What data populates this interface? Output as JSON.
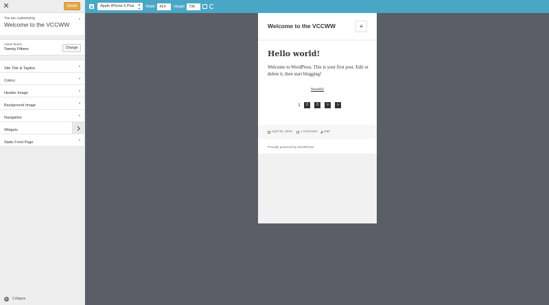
{
  "sidebar": {
    "close_glyph": "✕",
    "saved_label": "Saved",
    "info_pre": "You are customizing",
    "info_title": "Welcome to the VCCWW",
    "theme_pre": "Active theme",
    "theme_name": "Twenty Fifteen",
    "change_label": "Change",
    "sections": [
      {
        "label": "Site Title & Tagline"
      },
      {
        "label": "Colors"
      },
      {
        "label": "Header Image"
      },
      {
        "label": "Background Image"
      },
      {
        "label": "Navigation"
      },
      {
        "label": "Widgets"
      },
      {
        "label": "Static Front Page"
      }
    ],
    "collapse_label": "Collapse"
  },
  "toolbar": {
    "device": "Apple iPhone 6 Plus",
    "width_label": "Width",
    "width_value": "414",
    "height_label": "Height",
    "height_value": "736"
  },
  "preview": {
    "site_title": "Welcome to the VCCWW",
    "menu_glyph": "≡",
    "post_title": "Hello world!",
    "post_content": "Welcome to WordPress. This is your first post. Edit or delete it, then start blogging!",
    "next_link": "Next02",
    "pages": {
      "current": "1",
      "page2": "2",
      "page3": "3",
      "next": ">",
      "last": "»"
    },
    "meta": {
      "date": "April 30, 2015",
      "comments": "1 Comment",
      "edit": "Edit"
    },
    "footer": "Proudly powered by WordPress"
  },
  "colors": {
    "toolbar": "#49a7c5",
    "saved_button": "#e1a948",
    "canvas": "#5b5e67"
  }
}
